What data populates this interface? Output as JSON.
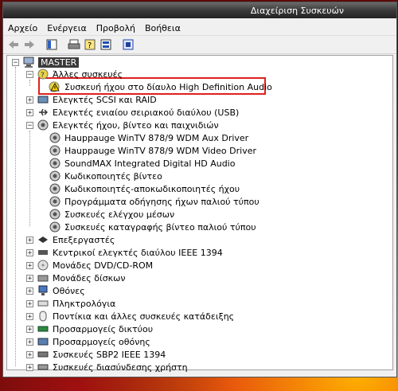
{
  "window": {
    "title": "Διαχείριση Συσκευών"
  },
  "menu": {
    "items": [
      "Αρχείο",
      "Ενέργεια",
      "Προβολή",
      "Βοήθεια"
    ]
  },
  "toolbar": {
    "buttons": [
      "back-arrow-icon",
      "forward-arrow-icon",
      "properties-icon",
      "print-icon",
      "help-icon",
      "view-icon",
      "scan-hardware-icon"
    ]
  },
  "tree": {
    "root": "MASTER",
    "nodes": [
      {
        "label": "Άλλες συσκευές",
        "expanded": true
      },
      {
        "label": "Συσκευή ήχου στο δίαυλο High Definition Audio",
        "child": true,
        "warning": true
      },
      {
        "label": "Ελεγκτές SCSI και RAID"
      },
      {
        "label": "Ελεγκτές ενιαίου σειριακού διαύλου (USB)"
      },
      {
        "label": "Ελεγκτές ήχου, βίντεο και παιχνιδιών",
        "expanded": true
      },
      {
        "label": "Hauppauge WinTV 878/9 WDM Aux Driver",
        "child": true
      },
      {
        "label": "Hauppauge WinTV 878/9 WDM Video Driver",
        "child": true
      },
      {
        "label": "SoundMAX Integrated Digital HD Audio",
        "child": true
      },
      {
        "label": "Κωδικοποιητές βίντεο",
        "child": true
      },
      {
        "label": "Κωδικοποιητές-αποκωδικοποιητές ήχου",
        "child": true
      },
      {
        "label": "Προγράμματα οδήγησης ήχων παλιού τύπου",
        "child": true
      },
      {
        "label": "Συσκευές ελέγχου μέσων",
        "child": true
      },
      {
        "label": "Συσκευές καταγραφής βίντεο παλιού τύπου",
        "child": true
      },
      {
        "label": "Επεξεργαστές"
      },
      {
        "label": "Κεντρικοί ελεγκτές διαύλου IEEE 1394"
      },
      {
        "label": "Μονάδες DVD/CD-ROM"
      },
      {
        "label": "Μονάδες δίσκων"
      },
      {
        "label": "Οθόνες"
      },
      {
        "label": "Πληκτρολόγια"
      },
      {
        "label": "Ποντίκια και άλλες συσκευές κατάδειξης"
      },
      {
        "label": "Προσαρμογείς δικτύου"
      },
      {
        "label": "Προσαρμογείς οθόνης"
      },
      {
        "label": "Συσκευές SBP2 IEEE 1394"
      },
      {
        "label": "Συσκευές διασύνδεσης χρήστη"
      }
    ]
  }
}
